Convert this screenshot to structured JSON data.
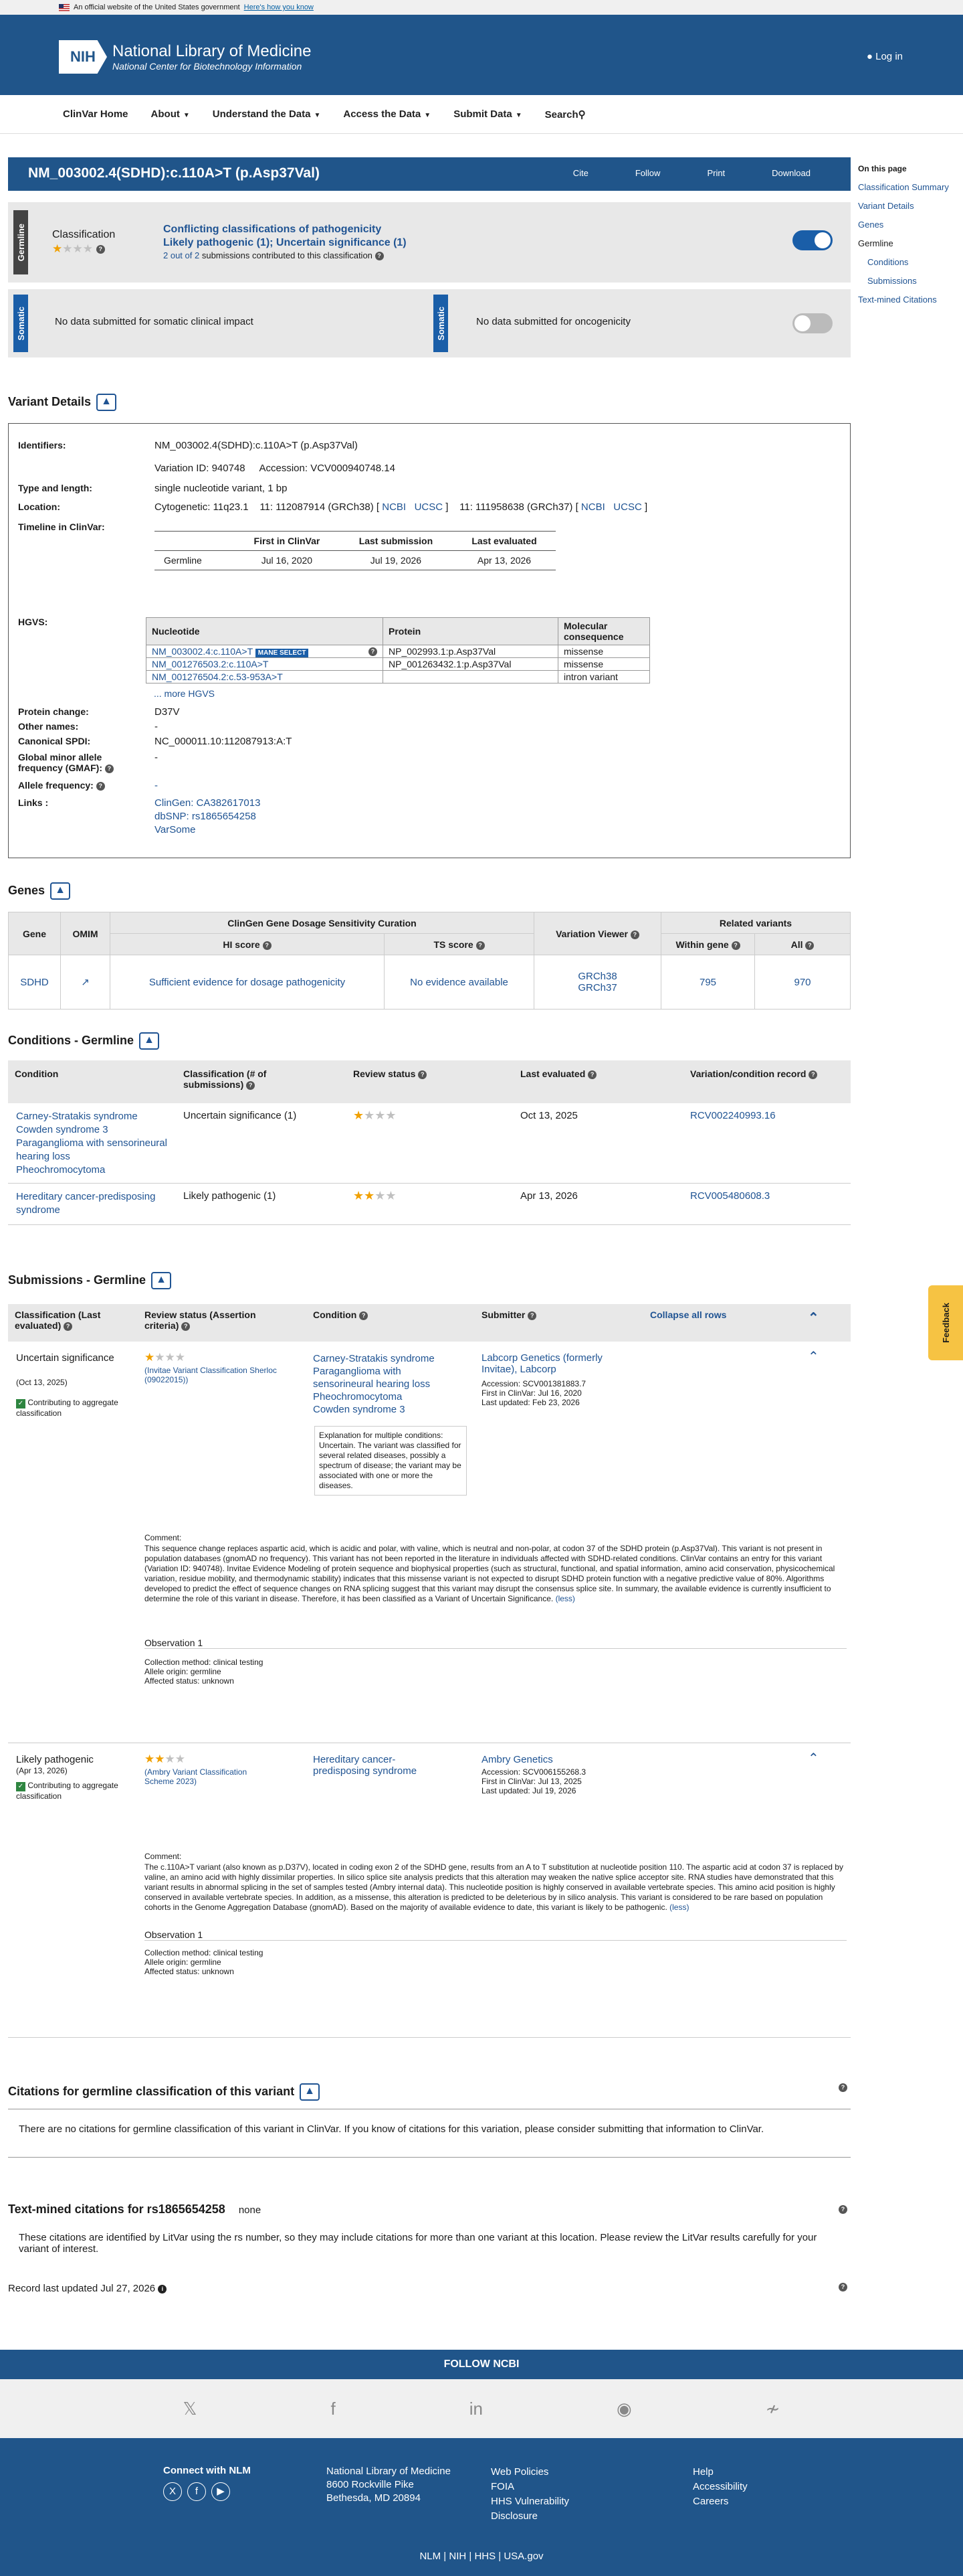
{
  "banner": {
    "text": "An official website of the United States government",
    "link": "Here's how you know"
  },
  "header": {
    "logo": "NIH",
    "title": "National Library of Medicine",
    "subtitle": "National Center for Biotechnology Information",
    "login": "Log in"
  },
  "nav": [
    "ClinVar Home",
    "About",
    "Understand the Data",
    "Access the Data",
    "Submit Data",
    "Search"
  ],
  "page": {
    "title": "NM_003002.4(SDHD):c.110A>T (p.Asp37Val)",
    "actions": [
      "Cite",
      "Follow",
      "Print",
      "Download"
    ]
  },
  "on_this_page": {
    "heading": "On this page",
    "items": [
      "Classification Summary",
      "Variant Details",
      "Genes",
      "Germline",
      "Conditions",
      "Submissions",
      "Text-mined Citations"
    ]
  },
  "germline": {
    "tab": "Germline",
    "label": "Classification",
    "conflict": "Conflicting classifications of pathogenicity",
    "detail": "Likely pathogenic (1); Uncertain significance (1)",
    "sub_count": "2 out of 2",
    "sub_text": "submissions contributed to this classification"
  },
  "somatic": {
    "tab": "Somatic",
    "clinical": "No data submitted for somatic clinical impact",
    "onco": "No data submitted for oncogenicity"
  },
  "variant": {
    "heading": "Variant Details",
    "identifiers_label": "Identifiers:",
    "identifier": "NM_003002.4(SDHD):c.110A>T (p.Asp37Val)",
    "variation_id": "Variation ID: 940748",
    "accession": "Accession: VCV000940748.14",
    "type_label": "Type and length:",
    "type": "single nucleotide variant, 1 bp",
    "location_label": "Location:",
    "cyto": "Cytogenetic: 11q23.1",
    "grch38": "11: 112087914 (GRCh38) [",
    "grch37": "11: 111958638 (GRCh37) [",
    "ncbi": "NCBI",
    "ucsc": "UCSC",
    "timeline_label": "Timeline in ClinVar:",
    "tl_headers": [
      "First in ClinVar",
      "Last submission",
      "Last evaluated"
    ],
    "tl_row": [
      "Germline",
      "Jul 16, 2020",
      "Jul 19, 2026",
      "Apr 13, 2026"
    ],
    "hgvs_label": "HGVS:",
    "hgvs_headers": [
      "Nucleotide",
      "Protein",
      "Molecular consequence"
    ],
    "hgvs_rows": [
      [
        "NM_003002.4:c.110A>T",
        "NP_002993.1:p.Asp37Val",
        "missense"
      ],
      [
        "NM_001276503.2:c.110A>T",
        "NP_001263432.1:p.Asp37Val",
        "missense"
      ],
      [
        "NM_001276504.2:c.53-953A>T",
        "",
        "intron variant"
      ]
    ],
    "mane": "MANE SELECT",
    "more": "... more HGVS",
    "protein_label": "Protein change:",
    "protein": "D37V",
    "other_label": "Other names:",
    "other": "-",
    "spdi_label": "Canonical SPDI:",
    "spdi": "NC_000011.10:112087913:A:T",
    "gmaf_label": "Global minor allele frequency (GMAF)",
    "gmaf": "-",
    "af_label": "Allele frequency",
    "af": "-",
    "links_label": "Links :",
    "links": [
      "ClinGen: CA382617013",
      "dbSNP: rs1865654258",
      "VarSome"
    ]
  },
  "genes": {
    "heading": "Genes",
    "h_gene": "Gene",
    "h_omim": "OMIM",
    "h_cg": "ClinGen Gene Dosage Sensitivity Curation",
    "h_hi": "HI score",
    "h_ts": "TS score",
    "h_vv": "Variation Viewer",
    "h_rel": "Related variants",
    "h_within": "Within gene",
    "h_all": "All",
    "gene": "SDHD",
    "hi": "Sufficient evidence for dosage pathogenicity",
    "ts": "No evidence available",
    "grch38": "GRCh38",
    "grch37": "GRCh37",
    "within": "795",
    "all": "970"
  },
  "conditions": {
    "heading": "Conditions - Germline",
    "headers": [
      "Condition",
      "Classification (# of submissions)",
      "Review status",
      "Last evaluated",
      "Variation/condition record"
    ],
    "rows": [
      {
        "conds": [
          "Carney-Stratakis syndrome",
          "Cowden syndrome 3",
          "Paraganglioma with sensorineural hearing loss",
          "Pheochromocytoma"
        ],
        "cls": "Uncertain significance (1)",
        "date": "Oct 13, 2025",
        "rec": "RCV002240993.16"
      },
      {
        "conds": [
          "Hereditary cancer-predisposing syndrome"
        ],
        "cls": "Likely pathogenic (1)",
        "date": "Apr 13, 2026",
        "rec": "RCV005480608.3"
      }
    ]
  },
  "submissions": {
    "heading": "Submissions - Germline",
    "h_cls": "Classification (Last evaluated)",
    "h_rev": "Review status (Assertion criteria)",
    "h_cond": "Condition",
    "h_sub": "Submitter",
    "collapse": "Collapse all rows",
    "s1": {
      "cls": "Uncertain significance",
      "date": "(Oct 13, 2025)",
      "contrib": "Contributing to aggregate classification",
      "crit": "(Invitae Variant Classification Sherloc (09022015))",
      "conds": [
        "Carney-Stratakis syndrome",
        "Paraganglioma with sensorineural hearing loss",
        "Pheochromocytoma",
        "Cowden syndrome 3"
      ],
      "expl": "Explanation for multiple conditions: Uncertain. The variant was classified for several related diseases, possibly a spectrum of disease; the variant may be associated with one or more the diseases.",
      "submitter": "Labcorp Genetics (formerly Invitae), Labcorp",
      "acc": "Accession: SCV001381883.7",
      "first": "First in ClinVar: Jul 16, 2020",
      "upd": "Last updated: Feb 23, 2026",
      "comment_label": "Comment:",
      "comment": "This sequence change replaces aspartic acid, which is acidic and polar, with valine, which is neutral and non-polar, at codon 37 of the SDHD protein (p.Asp37Val). This variant is not present in population databases (gnomAD no frequency). This variant has not been reported in the literature in individuals affected with SDHD-related conditions. ClinVar contains an entry for this variant (Variation ID: 940748). Invitae Evidence Modeling of protein sequence and biophysical properties (such as structural, functional, and spatial information, amino acid conservation, physicochemical variation, residue mobility, and thermodynamic stability) indicates that this missense variant is not expected to disrupt SDHD protein function with a negative predictive value of 80%. Algorithms developed to predict the effect of sequence changes on RNA splicing suggest that this variant may disrupt the consensus splice site. In summary, the available evidence is currently insufficient to determine the role of this variant in disease. Therefore, it has been classified as a Variant of Uncertain Significance.",
      "less": "(less)",
      "obs": "Observation 1",
      "m1": "Collection method: clinical testing",
      "m2": "Allele origin: germline",
      "m3": "Affected status: unknown"
    },
    "s2": {
      "cls": "Likely pathogenic",
      "date": "(Apr 13, 2026)",
      "contrib": "Contributing to aggregate classification",
      "crit": "(Ambry Variant Classification Scheme 2023)",
      "conds": [
        "Hereditary cancer-predisposing syndrome"
      ],
      "submitter": "Ambry Genetics",
      "acc": "Accession: SCV006155268.3",
      "first": "First in ClinVar: Jul 13, 2025",
      "upd": "Last updated: Jul 19, 2026",
      "comment_label": "Comment:",
      "comment": "The c.110A>T variant (also known as p.D37V), located in coding exon 2 of the SDHD gene, results from an A to T substitution at nucleotide position 110. The aspartic acid at codon 37 is replaced by valine, an amino acid with highly dissimilar properties. In silico splice site analysis predicts that this alteration may weaken the native splice acceptor site. RNA studies have demonstrated that this variant results in abnormal splicing in the set of samples tested (Ambry internal data). This nucleotide position is highly conserved in available vertebrate species. This amino acid position is highly conserved in available vertebrate species. In addition, as a missense, this alteration is predicted to be deleterious by in silico analysis. This variant is considered to be rare based on population cohorts in the Genome Aggregation Database (gnomAD). Based on the majority of available evidence to date, this variant is likely to be pathogenic.",
      "less": "(less)",
      "obs": "Observation 1",
      "m1": "Collection method: clinical testing",
      "m2": "Allele origin: germline",
      "m3": "Affected status: unknown"
    }
  },
  "citations": {
    "heading": "Citations for germline classification of this variant",
    "text": "There are no citations for germline classification of this variant in ClinVar. If you know of citations for this variation, please consider submitting that information to ClinVar.",
    "tm_heading": "Text-mined citations for rs1865654258",
    "tm_none": "none",
    "tm_text": "These citations are identified by LitVar using the rs number, so they may include citations for more than one variant at this location. Please review the LitVar results carefully for your variant of interest.",
    "record": "Record last updated Jul 27, 2026"
  },
  "feedback": "Feedback",
  "footer": {
    "follow": "FOLLOW NCBI",
    "connect": "Connect with NLM",
    "addr": [
      "National Library of Medicine",
      "8600 Rockville Pike",
      "Bethesda, MD 20894"
    ],
    "col3": [
      "Web Policies",
      "FOIA",
      "HHS Vulnerability Disclosure"
    ],
    "col4": [
      "Help",
      "Accessibility",
      "Careers"
    ],
    "bottom": [
      "NLM",
      "NIH",
      "HHS",
      "USA.gov"
    ]
  }
}
